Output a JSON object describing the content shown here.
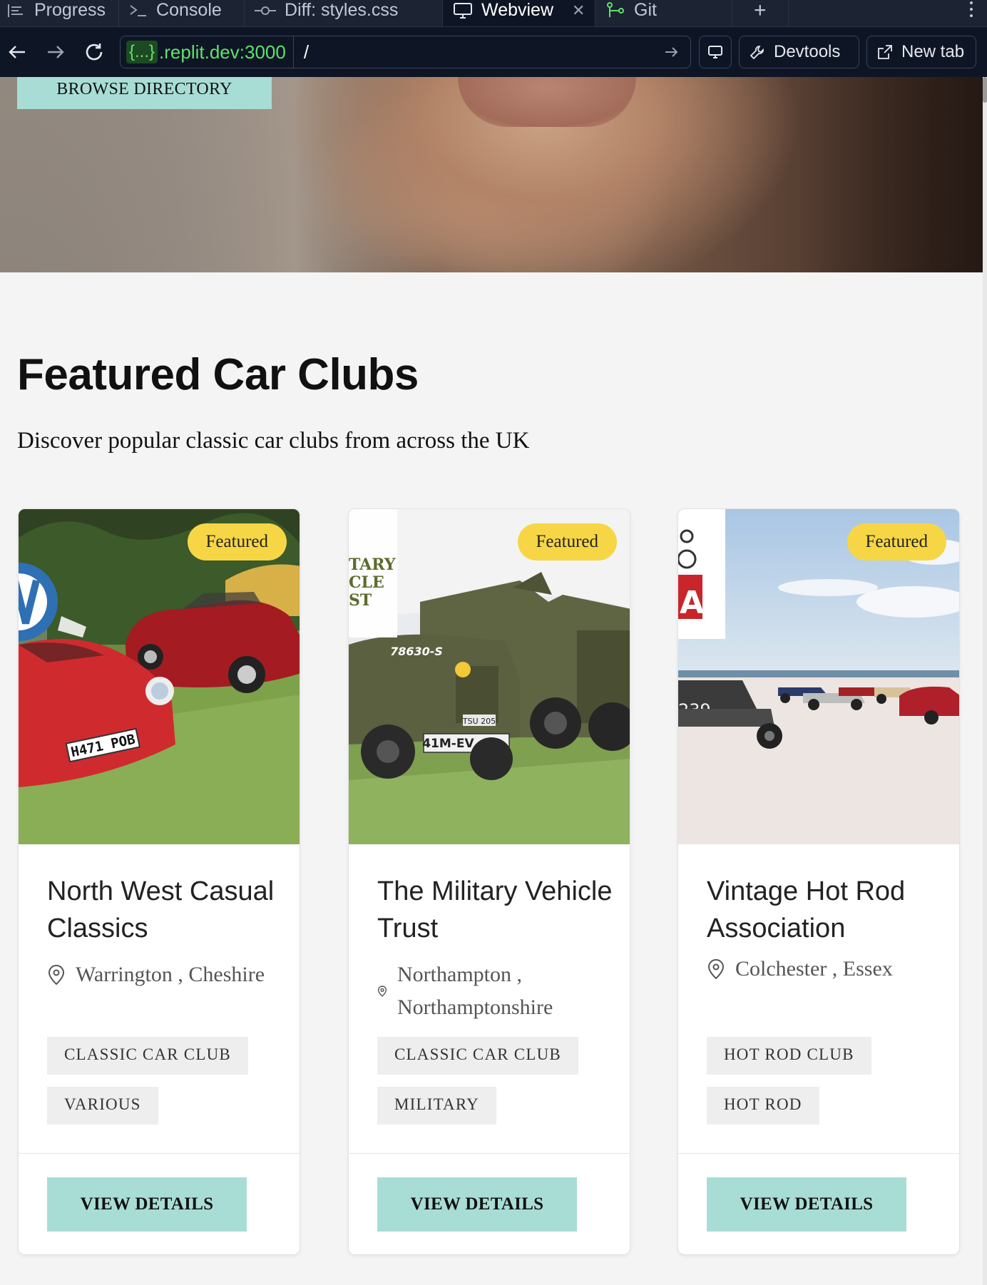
{
  "ide": {
    "tabs": [
      {
        "label": "Progress",
        "icon": "progress-icon"
      },
      {
        "label": "Console",
        "icon": "console-icon"
      },
      {
        "label": "Diff: styles.css",
        "icon": "diff-icon"
      },
      {
        "label": "Webview",
        "icon": "monitor-icon",
        "active": true
      },
      {
        "label": "Git",
        "icon": "git-icon"
      }
    ],
    "url_badge": "{...}",
    "url_host": ".replit.dev:3000",
    "url_path": "/",
    "devtools_label": "Devtools",
    "new_tab_label": "New tab",
    "accent_green": "#5ee36a"
  },
  "hero": {
    "browse_label": "BROWSE DIRECTORY"
  },
  "section": {
    "title": "Featured Car Clubs",
    "subtitle": "Discover popular classic car clubs from across the UK"
  },
  "cards": [
    {
      "badge": "Featured",
      "name": "North West Casual Classics",
      "location": "Warrington , Cheshire",
      "tags": [
        "CLASSIC CAR CLUB",
        "VARIOUS"
      ],
      "button": "VIEW DETAILS",
      "plate": "H471 POB"
    },
    {
      "badge": "Featured",
      "name": "The Military Vehicle Trust",
      "location": "Northampton , Northamptonshire",
      "tags": [
        "CLASSIC CAR CLUB",
        "MILITARY"
      ],
      "button": "VIEW DETAILS",
      "logo_text": [
        "TARY",
        "CLE",
        "ST"
      ],
      "markings": [
        "78630-S",
        "41M-EV",
        "TSU 205"
      ]
    },
    {
      "badge": "Featured",
      "name": "Vintage Hot Rod Association",
      "location": "Colchester , Essex",
      "tags": [
        "HOT ROD CLUB",
        "HOT ROD"
      ],
      "button": "VIEW DETAILS",
      "logo_text": "A",
      "car_number": "239"
    }
  ],
  "colors": {
    "button_teal": "#a8ddd5",
    "featured_yellow": "#f7d646"
  }
}
